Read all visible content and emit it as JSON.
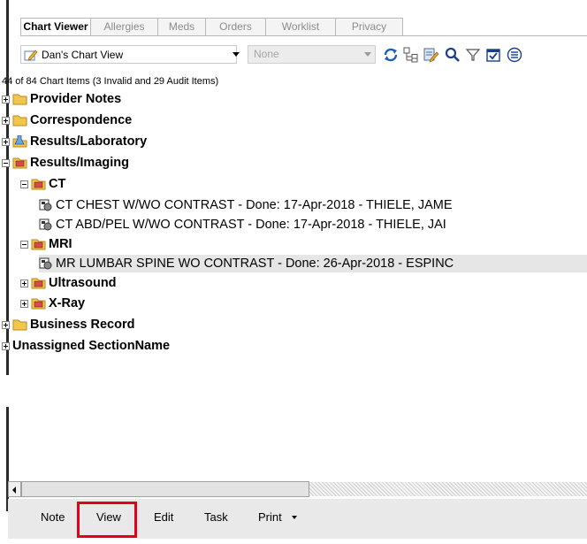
{
  "tabs": [
    "Chart Viewer",
    "Allergies",
    "Meds",
    "Orders",
    "Worklist",
    "Privacy"
  ],
  "toolbar": {
    "view_value": "Dan's Chart View",
    "filter_value": "None",
    "icons": [
      "refresh-icon",
      "tree-expand-icon",
      "edit-note-icon",
      "search-icon",
      "filter-icon",
      "calendar-check-icon",
      "menu-icon"
    ]
  },
  "status_text": "44 of 84 Chart Items (3 Invalid and 29 Audit Items)",
  "tree": [
    {
      "label": "Provider Notes"
    },
    {
      "label": "Correspondence"
    },
    {
      "label": "Results/Laboratory"
    },
    {
      "label": "Results/Imaging"
    },
    {
      "label": "CT"
    },
    {
      "label": "CT CHEST W/WO CONTRAST - Done: 17-Apr-2018 - THIELE, JAME"
    },
    {
      "label": "CT ABD/PEL W/WO CONTRAST - Done: 17-Apr-2018 - THIELE, JAI"
    },
    {
      "label": "MRI"
    },
    {
      "label": "MR LUMBAR SPINE WO CONTRAST - Done: 26-Apr-2018 - ESPINC"
    },
    {
      "label": "Ultrasound"
    },
    {
      "label": "X-Ray"
    },
    {
      "label": "Business Record"
    },
    {
      "label": "Unassigned SectionName"
    }
  ],
  "actions": {
    "note": "Note",
    "view": "View",
    "edit": "Edit",
    "task": "Task",
    "print": "Print"
  },
  "colors": {
    "highlight": "#e3001b",
    "folder": "#f3c64c",
    "imaging_folder": "#d94b4b"
  }
}
